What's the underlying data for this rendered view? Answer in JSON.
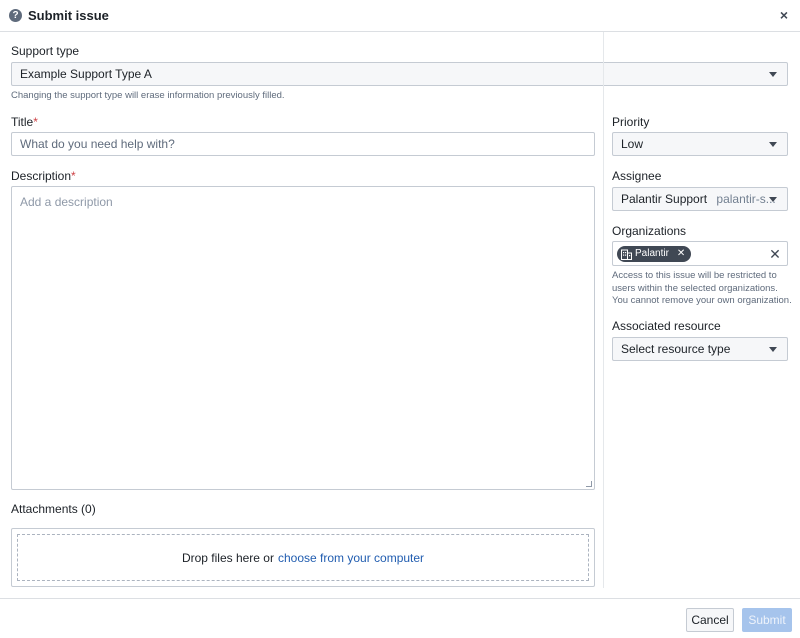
{
  "header": {
    "title": "Submit issue",
    "help_icon": "help-circle-icon",
    "help_glyph": "?",
    "close_icon": "close-icon",
    "close_glyph": "×"
  },
  "support_type": {
    "label": "Support type",
    "value": "Example Support Type A",
    "helper": "Changing the support type will erase information previously filled."
  },
  "title_field": {
    "label": "Title",
    "required_mark": "*",
    "placeholder": "What do you need help with?"
  },
  "description_field": {
    "label": "Description",
    "required_mark": "*",
    "placeholder": "Add a description"
  },
  "attachments": {
    "label": "Attachments (0)",
    "drop_text": "Drop files here or",
    "choose_link": "choose from your computer"
  },
  "priority": {
    "label": "Priority",
    "value": "Low"
  },
  "assignee": {
    "label": "Assignee",
    "name": "Palantir Support",
    "handle": "palantir-s..."
  },
  "organizations": {
    "label": "Organizations",
    "tags": [
      {
        "label": "Palantir",
        "icon": "organization-icon",
        "remove_glyph": "✕"
      }
    ],
    "clear_glyph": "✕",
    "helper": "Access to this issue will be restricted to users within the selected organizations. You cannot remove your own organization."
  },
  "associated_resource": {
    "label": "Associated resource",
    "value": "Select resource type"
  },
  "footer": {
    "cancel_label": "Cancel",
    "submit_label": "Submit"
  },
  "colors": {
    "primary_disabled": "#a6c4ec",
    "link": "#215db0",
    "required": "#cd4246",
    "tag_bg": "#404854"
  }
}
